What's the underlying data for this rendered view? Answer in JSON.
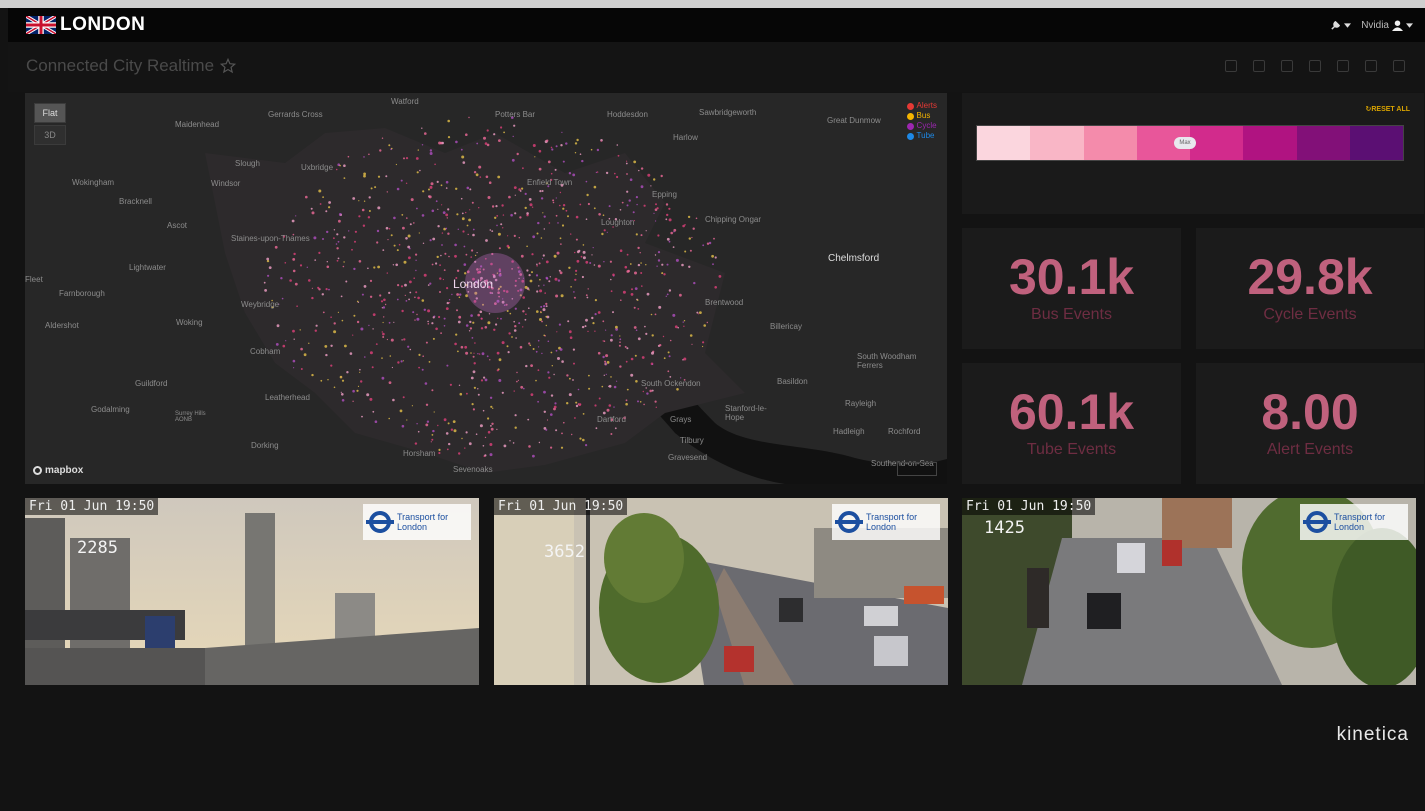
{
  "header": {
    "brand": "LONDON",
    "user_name": "Nvidia"
  },
  "dashboard": {
    "title": "Connected City Realtime"
  },
  "map": {
    "view_buttons": [
      "Flat",
      "3D"
    ],
    "legend": [
      {
        "label": "Alerts",
        "color": "#e53935"
      },
      {
        "label": "Bus",
        "color": "#f4b400"
      },
      {
        "label": "Cycle",
        "color": "#9c27b0"
      },
      {
        "label": "Tube",
        "color": "#1e88e5"
      }
    ],
    "places": [
      "Watford",
      "Gerrards Cross",
      "Potters Bar",
      "Hoddesdon",
      "Sawbridgeworth",
      "Great Dunmow",
      "Maidenhead",
      "Harlow",
      "Slough",
      "Uxbridge",
      "Enfield Town",
      "Epping",
      "Wokingham",
      "Windsor",
      "Bracknell",
      "Loughton",
      "Chipping Ongar",
      "Ascot",
      "Staines-upon-Thames",
      "Chelmsford",
      "Lightwater",
      "Fleet",
      "Farnborough",
      "London",
      "Brentwood",
      "Weybridge",
      "Woking",
      "Billericay",
      "Aldershot",
      "Cobham",
      "Guildford",
      "Leatherhead",
      "Basildon",
      "South Woodham Ferrers",
      "Godalming",
      "Surrey Hills AONB",
      "Dorking",
      "Horsham",
      "Grays",
      "Tilbury",
      "Stanford-le-Hope",
      "Gravesend",
      "Rayleigh",
      "Rochford",
      "Hadleigh",
      "South Ockendon",
      "Dartford",
      "Sevenoaks",
      "Southend-on-Sea"
    ],
    "attribution": "mapbox"
  },
  "filter": {
    "reset_label": "RESET ALL",
    "handle_label": "Max",
    "gradient_colors": [
      "#fbd6de",
      "#f9b6c6",
      "#f48bab",
      "#e8569a",
      "#d22b8c",
      "#b01381",
      "#821078",
      "#5b0f73"
    ]
  },
  "metrics": [
    {
      "value": "30.1k",
      "label": "Bus Events"
    },
    {
      "value": "29.8k",
      "label": "Cycle Events"
    },
    {
      "value": "60.1k",
      "label": "Tube Events"
    },
    {
      "value": "8.00",
      "label": "Alert Events"
    }
  ],
  "cameras": [
    {
      "timestamp": "Fri 01 Jun 19:50",
      "count": "2285",
      "logo": "Transport for London"
    },
    {
      "timestamp": "Fri 01 Jun 19:50",
      "count": "3652",
      "logo": "Transport for London"
    },
    {
      "timestamp": "Fri 01 Jun 19:50",
      "count": "1425",
      "logo": "Transport for London"
    }
  ],
  "footer": {
    "brand": "kinetica"
  },
  "colors": {
    "metric_value": "#c0617d",
    "metric_label": "#6e2d42",
    "background": "#131313"
  }
}
